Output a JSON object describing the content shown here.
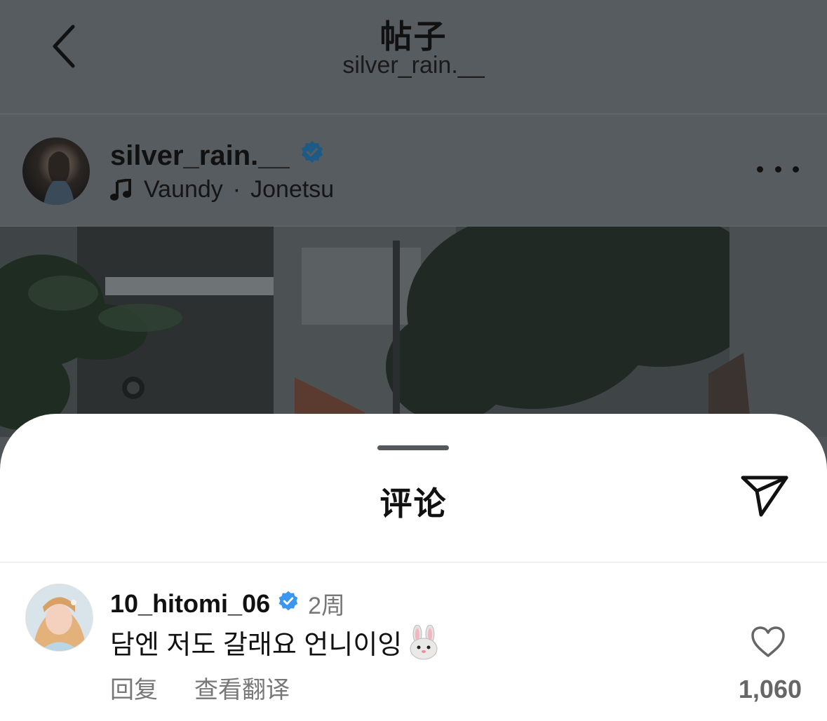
{
  "header": {
    "title": "帖子",
    "subtitle": "silver_rain.__"
  },
  "post": {
    "username": "silver_rain.__",
    "verified": true,
    "music": {
      "artist": "Vaundy",
      "separator": "·",
      "track": "Jonetsu"
    }
  },
  "comments_sheet": {
    "title": "评论",
    "comments": [
      {
        "username": "10_hitomi_06",
        "verified": true,
        "time": "2周",
        "text": "담엔 저도 갈래요 언니이잉",
        "emoji": "rabbit-face",
        "reply_label": "回复",
        "translate_label": "查看翻译",
        "like_count": "1,060"
      }
    ]
  },
  "colors": {
    "verified_blue": "#3897f0",
    "overlay": "#575c60",
    "sheet_bg": "#ffffff",
    "secondary_text": "#777777"
  },
  "icons": [
    "chevron-left-icon",
    "verified-badge-icon",
    "music-note-icon",
    "more-icon",
    "share-icon",
    "heart-icon",
    "rabbit-emoji-icon"
  ]
}
